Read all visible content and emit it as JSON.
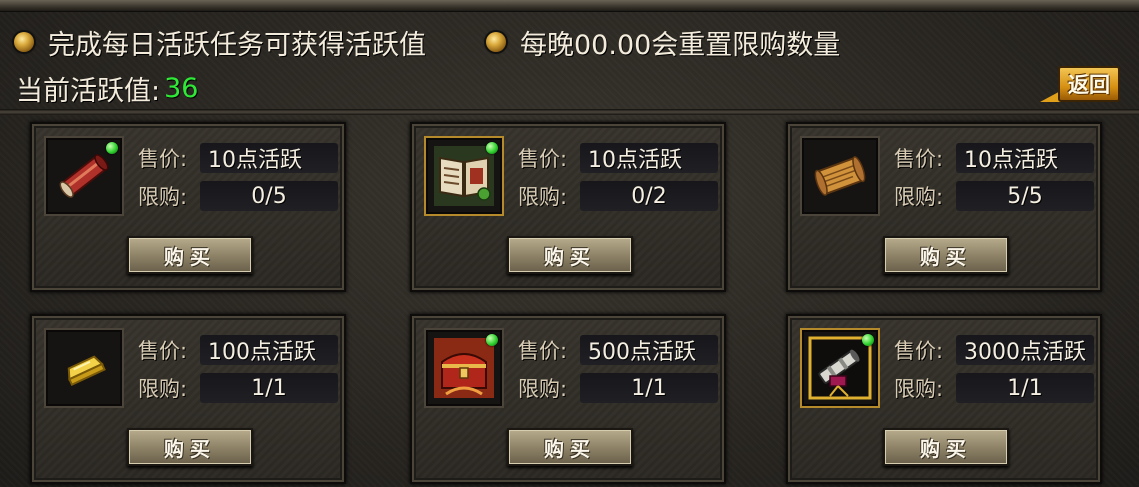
{
  "notices": [
    {
      "text": "完成每日活跃任务可获得活跃值"
    },
    {
      "text": "每晚00.00会重置限购数量"
    }
  ],
  "activity": {
    "label": "当前活跃值:",
    "value": "36"
  },
  "back_button": "返回",
  "labels": {
    "price": "售价:",
    "limit": "限购:"
  },
  "buy_label": "购买",
  "colors": {
    "activity_value": "#2eea37",
    "back_button": "#d58f12",
    "gem": "#2ed12e"
  },
  "shop_items": [
    {
      "icon": "red-scroll-icon",
      "price": "10点活跃",
      "limit": "0/5"
    },
    {
      "icon": "skill-book-icon",
      "price": "10点活跃",
      "limit": "0/2"
    },
    {
      "icon": "parchment-scroll-icon",
      "price": "10点活跃",
      "limit": "5/5"
    },
    {
      "icon": "gold-bar-icon",
      "price": "100点活跃",
      "limit": "1/1"
    },
    {
      "icon": "red-treasure-chest-icon",
      "price": "500点活跃",
      "limit": "1/1"
    },
    {
      "icon": "telescope-icon",
      "price": "3000点活跃",
      "limit": "1/1"
    }
  ]
}
